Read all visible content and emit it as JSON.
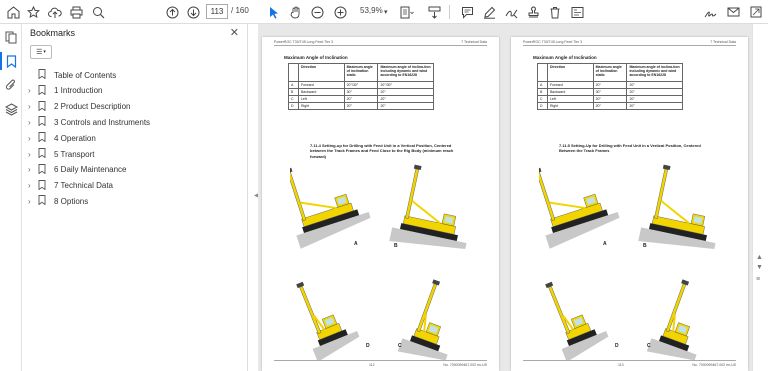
{
  "toolbar": {
    "page_current": "113",
    "page_total": "/ 160",
    "zoom": "53,9%"
  },
  "bookmarks": {
    "title": "Bookmarks",
    "items": [
      {
        "label": "Table of Contents",
        "has_children": false
      },
      {
        "label": "1 Introduction",
        "has_children": true
      },
      {
        "label": "2 Product Description",
        "has_children": true
      },
      {
        "label": "3 Controls and Instruments",
        "has_children": true
      },
      {
        "label": "4 Operation",
        "has_children": true
      },
      {
        "label": "5 Transport",
        "has_children": true
      },
      {
        "label": "6 Daily Maintenance",
        "has_children": true
      },
      {
        "label": "7 Technical Data",
        "has_children": true
      },
      {
        "label": "8 Options",
        "has_children": true
      }
    ]
  },
  "pages": [
    {
      "header_left": "PowerROC T30/T45 Long Feed Tier 3",
      "header_right": "7 Technical Data",
      "section_title": "Maximum Angle of Inclination",
      "table": {
        "headers": [
          "",
          "Direction",
          "Maximum angle of inclination static",
          "Maximum angle of inclina-tion including dynamic and wind according to EN16228"
        ],
        "rows": [
          [
            "A",
            "Forward",
            "20°/30°",
            "20°/30°"
          ],
          [
            "B",
            "Backward",
            "30°",
            "20°"
          ],
          [
            "C",
            "Left",
            "20°",
            "20°"
          ],
          [
            "D",
            "Right",
            "20°",
            "20°"
          ]
        ]
      },
      "figure_caption": "7.11.4 Setting-up for Drilling with Feed Unit in a Vertical Position, Centered between the Track Frames and Feed Close to the Rig Body (minimum reach forward)",
      "fig_labels": [
        "A",
        "B",
        "D",
        "C"
      ],
      "page_number": "112",
      "doc_number": "No. 7000099467.002 en-US"
    },
    {
      "header_left": "PowerROC T30/T45 Long Feed Tier 3",
      "header_right": "7 Technical Data",
      "section_title": "Maximum Angle of Inclination",
      "table": {
        "headers": [
          "",
          "Direction",
          "Maximum angle of inclination static",
          "Maximum angle of inclina-tion including dynamic and wind according to EN16228"
        ],
        "rows": [
          [
            "A",
            "Forward",
            "20°",
            "20°"
          ],
          [
            "B",
            "Backward",
            "30°",
            "20°"
          ],
          [
            "C",
            "Left",
            "20°",
            "20°"
          ],
          [
            "D",
            "Right",
            "20°",
            "20°"
          ]
        ]
      },
      "figure_caption": "7.11.5 Setting-Up for Drilling with Feed Unit in a Vertical Position, Centered Between the Track Frames",
      "fig_labels": [
        "A",
        "B",
        "D",
        "C"
      ],
      "page_number": "113",
      "doc_number": "No. 7000099467.002 en-US"
    }
  ],
  "colors": {
    "accent": "#1473e6",
    "rig_yellow": "#f2d500",
    "ground": "#9a9a9a"
  }
}
